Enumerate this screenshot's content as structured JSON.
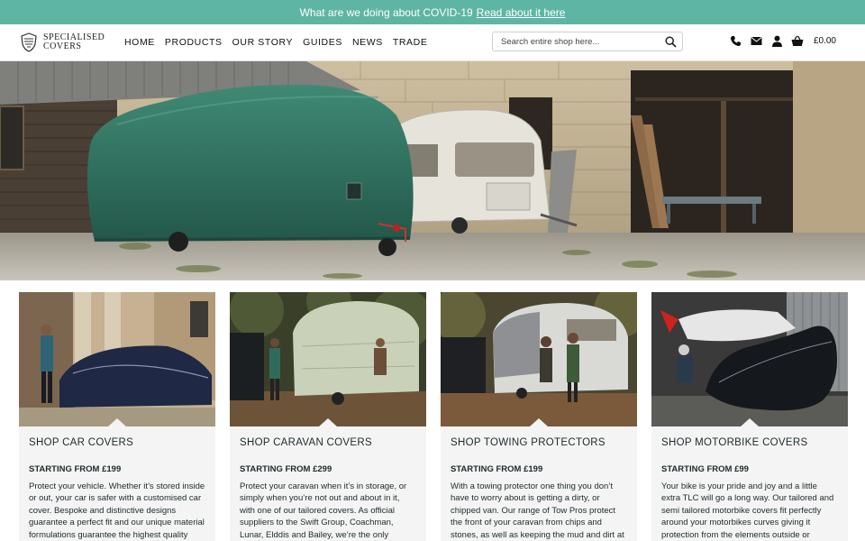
{
  "announcement": {
    "text": "What are we doing about COVID-19",
    "link": "Read about it here"
  },
  "brand": {
    "line1": "SPECIALISED",
    "line2": "COVERS"
  },
  "nav": [
    "HOME",
    "PRODUCTS",
    "OUR STORY",
    "GUIDES",
    "NEWS",
    "TRADE"
  ],
  "search": {
    "placeholder": "Search entire shop here..."
  },
  "cart": {
    "total": "£0.00"
  },
  "colors": {
    "announcement_bar": "#5fb5a3",
    "card_bg": "#f4f4f4"
  },
  "cards": [
    {
      "title": "SHOP CAR COVERS",
      "price": "STARTING FROM £199",
      "description": "Protect your vehicle. Whether it’s stored inside or out, your car is safer with a customised car cover. Bespoke and distinctive designs guarantee a perfect fit and our unique material formulations guarantee the highest quality"
    },
    {
      "title": "SHOP CARAVAN COVERS",
      "price": "STARTING FROM £299",
      "description": "Protect your caravan when it’s in storage, or simply when you’re not out and about in it, with one of our tailored covers. As official suppliers to the Swift Group, Coachman, Lunar, Elddis and Bailey, we’re the only caravan protection brand"
    },
    {
      "title": "SHOP TOWING PROTECTORS",
      "price": "STARTING FROM £199",
      "description": "With a towing protector one thing you don’t have to worry about is getting a dirty, or chipped van. Our range of Tow Pros protect the front of your caravan from chips and stones, as well as keeping the mud and dirt at bay. With the"
    },
    {
      "title": "SHOP MOTORBIKE COVERS",
      "price": "STARTING FROM £99",
      "description": "Your bike is your pride and joy and a little extra TLC will go a long way. Our tailored and semi tailored motorbike covers fit perfectly around your motorbikes curves giving it protection from the elements outside or mishaps inside,"
    }
  ]
}
